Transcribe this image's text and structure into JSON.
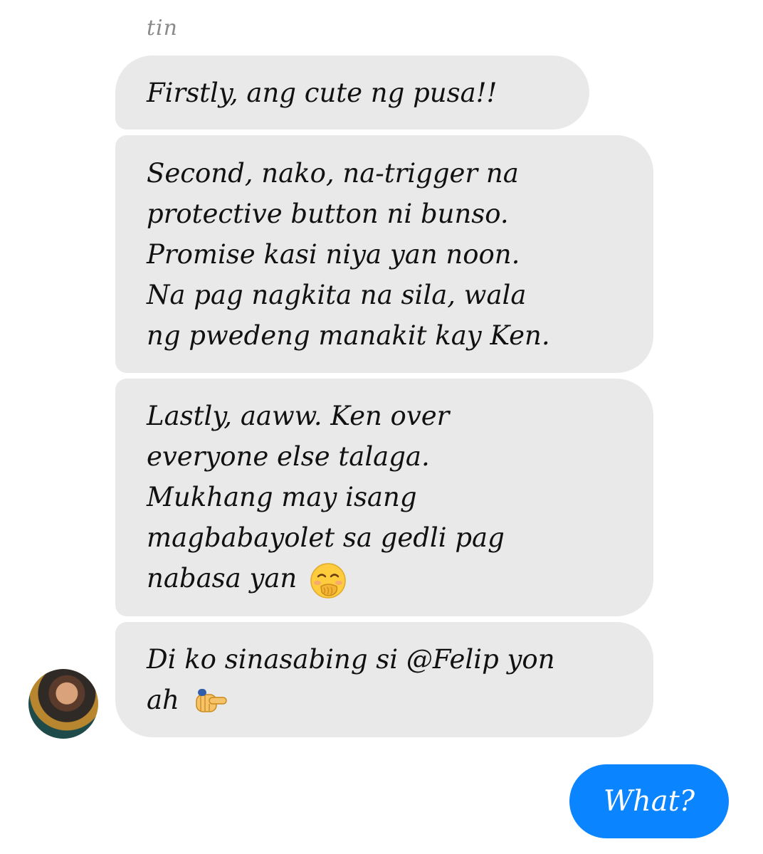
{
  "conversation": {
    "sender_name": "tin",
    "received_messages": [
      {
        "text": "Firstly, ang cute ng pusa!!"
      },
      {
        "text": "Second, nako, na-trigger na\nprotective button ni bunso.\nPromise kasi niya yan noon.\nNa pag nagkita na sila, wala\nng pwedeng manakit kay Ken."
      },
      {
        "text": "Lastly, aaww. Ken over\neveryone else talaga.\nMukhang may isang\nmagbabayolet sa gedli pag\nnabasa yan ",
        "emoji": "face-with-hand-over-mouth-icon"
      },
      {
        "text": "Di ko sinasabing si @Felip yon\nah ",
        "emoji": "backhand-index-pointing-right-icon"
      }
    ],
    "sent_messages": [
      {
        "text": "What?"
      }
    ]
  },
  "colors": {
    "received_bubble": "#e9e9e9",
    "sent_bubble": "#0a84ff",
    "sender_name": "#8a8a8a"
  }
}
